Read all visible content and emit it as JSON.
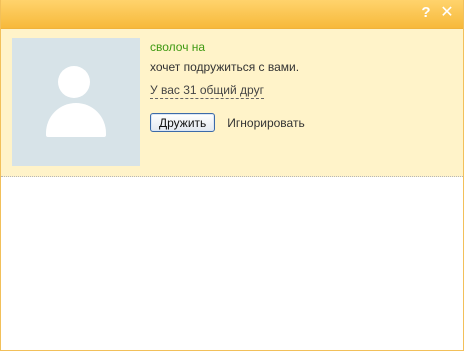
{
  "titlebar": {
    "help_icon": "?",
    "close_icon": "✕"
  },
  "request": {
    "name": "сволоч на",
    "message": "хочет подружиться с вами.",
    "mutual_friends": "У вас 31 общий друг",
    "accept_label": "Дружить",
    "ignore_label": "Игнорировать"
  },
  "colors": {
    "titlebar": "#f7b93b",
    "panel": "#fff3c9",
    "name": "#3f9a12",
    "avatar_bg": "#d7e3e8"
  }
}
